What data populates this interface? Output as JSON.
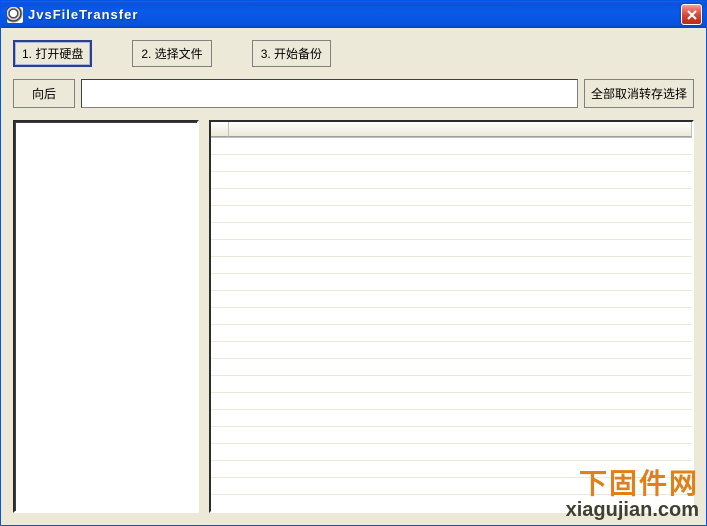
{
  "window": {
    "title": "JvsFileTransfer"
  },
  "toolbar": {
    "step1_label": "1. 打开硬盘",
    "step2_label": "2. 选择文件",
    "step3_label": "3. 开始备份",
    "back_label": "向后",
    "path_value": "",
    "deselect_all_label": "全部取消转存选择"
  },
  "watermark": {
    "text_cn": "下固件网",
    "url": "xiagujian.com"
  }
}
